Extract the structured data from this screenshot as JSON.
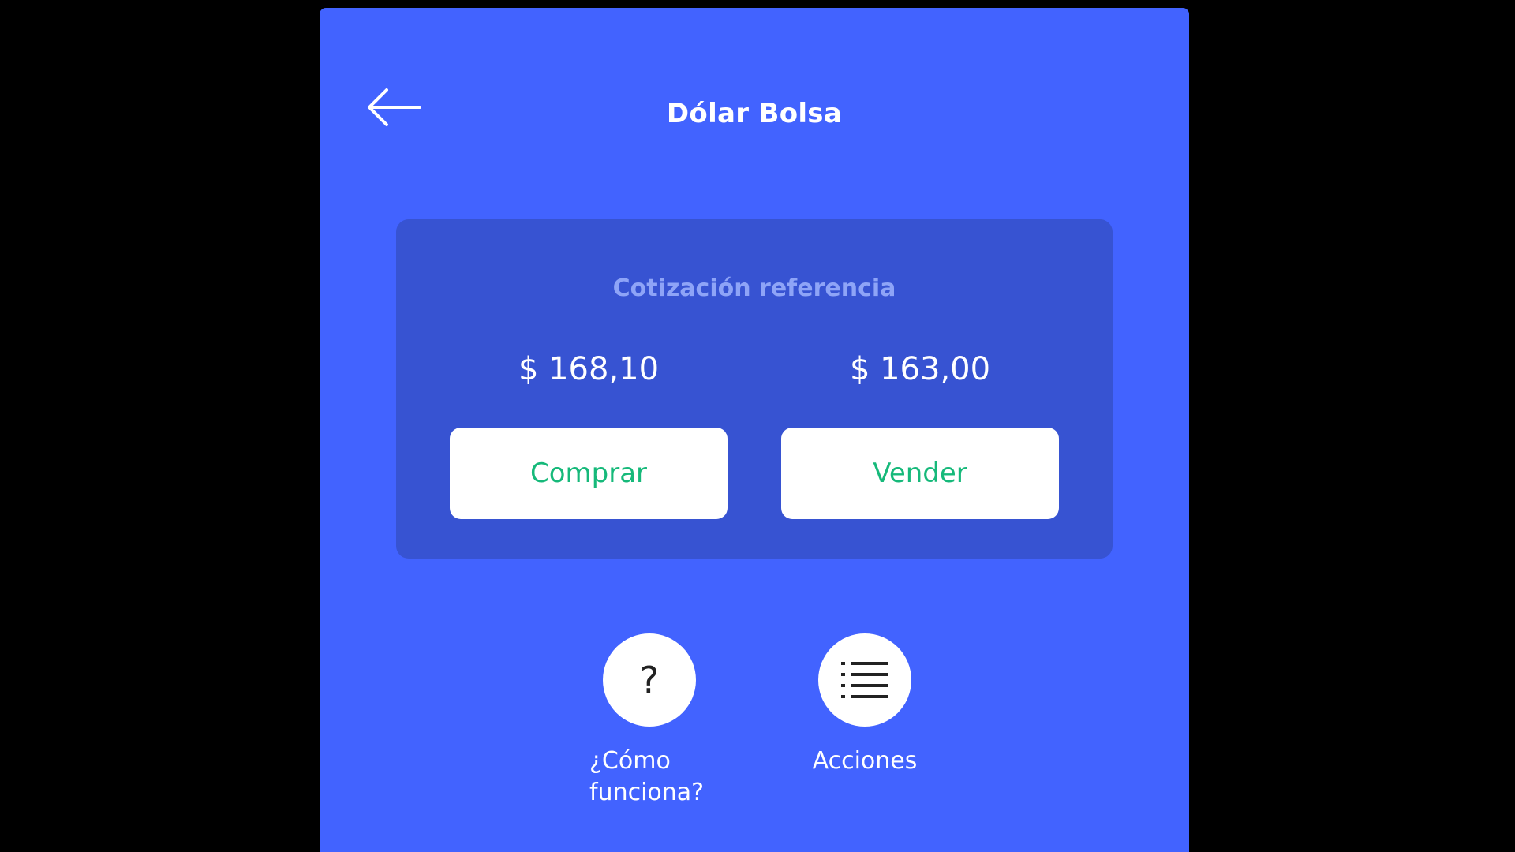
{
  "header": {
    "title": "Dólar Bolsa",
    "back_icon": "arrow-left-icon"
  },
  "quote_card": {
    "title": "Cotización referencia",
    "buy_price": "$ 168,10",
    "sell_price": "$ 163,00",
    "buy_label": "Comprar",
    "sell_label": "Vender"
  },
  "actions": [
    {
      "icon": "question-icon",
      "glyph": "?",
      "label": "¿Cómo funciona?"
    },
    {
      "icon": "list-icon",
      "label": "Acciones"
    }
  ],
  "colors": {
    "background": "#4263FF",
    "card": "#3753D2",
    "card_title": "#8EA4F7",
    "button_text": "#16B97A",
    "outer": "#000000"
  }
}
